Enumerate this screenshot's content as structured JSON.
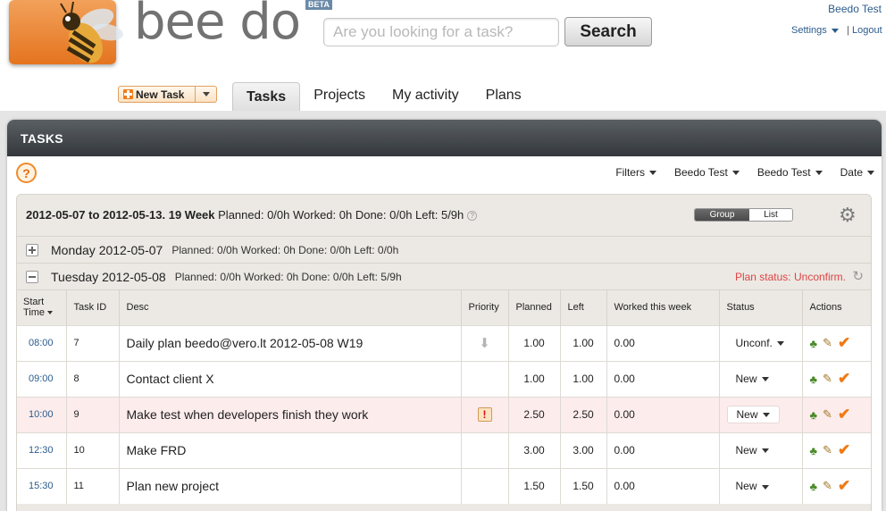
{
  "header": {
    "brand": "bee do",
    "beta_badge": "BETA",
    "search_placeholder": "Are you looking for a task?",
    "search_button": "Search",
    "user_name": "Beedo Test",
    "settings_label": "Settings",
    "separator": "|",
    "logout_label": "Logout"
  },
  "toolbar": {
    "new_task_label": "New Task",
    "tabs": [
      {
        "label": "Tasks",
        "active": true
      },
      {
        "label": "Projects",
        "active": false
      },
      {
        "label": "My activity",
        "active": false
      },
      {
        "label": "Plans",
        "active": false
      }
    ]
  },
  "panel": {
    "title": "TASKS",
    "help_icon": "?",
    "filters": [
      "Filters",
      "Beedo Test",
      "Beedo Test",
      "Date"
    ]
  },
  "week": {
    "range": "2012-05-07 to 2012-05-13. 19 Week",
    "stats": "Planned: 0/0h  Worked: 0h  Done: 0/0h  Left: 5/9h",
    "view_group": "Group",
    "view_list": "List"
  },
  "days": [
    {
      "label": "Monday 2012-05-07",
      "stats": "Planned: 0/0h  Worked: 0h  Done: 0/0h  Left: 0/0h",
      "expanded": false
    },
    {
      "label": "Tuesday 2012-05-08",
      "stats": "Planned: 0/0h  Worked: 0h  Done: 0/0h  Left: 5/9h",
      "expanded": true,
      "plan_status": "Plan status: Unconfirm."
    }
  ],
  "table": {
    "headers": {
      "start_time_1": "Start",
      "start_time_2": "Time",
      "task_id": "Task ID",
      "desc": "Desc",
      "priority": "Priority",
      "planned": "Planned",
      "left": "Left",
      "worked": "Worked this week",
      "status": "Status",
      "actions": "Actions"
    },
    "rows": [
      {
        "time": "08:00",
        "id": "7",
        "desc": "Daily plan beedo@vero.lt 2012-05-08 W19",
        "priority": "low",
        "planned": "1.00",
        "left": "1.00",
        "worked": "0.00",
        "status": "Unconf."
      },
      {
        "time": "09:00",
        "id": "8",
        "desc": "Contact client X",
        "priority": "",
        "planned": "1.00",
        "left": "1.00",
        "worked": "0.00",
        "status": "New"
      },
      {
        "time": "10:00",
        "id": "9",
        "desc": "Make test when developers finish they work",
        "priority": "high",
        "planned": "2.50",
        "left": "2.50",
        "worked": "0.00",
        "status": "New"
      },
      {
        "time": "12:30",
        "id": "10",
        "desc": "Make FRD",
        "priority": "",
        "planned": "3.00",
        "left": "3.00",
        "worked": "0.00",
        "status": "New"
      },
      {
        "time": "15:30",
        "id": "11",
        "desc": "Plan new project",
        "priority": "",
        "planned": "1.50",
        "left": "1.50",
        "worked": "0.00",
        "status": "New"
      }
    ]
  },
  "colors": {
    "accent_orange": "#f07b1a",
    "link_blue": "#2b5b8c",
    "header_dark": "#34383c",
    "plan_status_red": "#dd4444",
    "highlight_row": "#fcecec"
  }
}
